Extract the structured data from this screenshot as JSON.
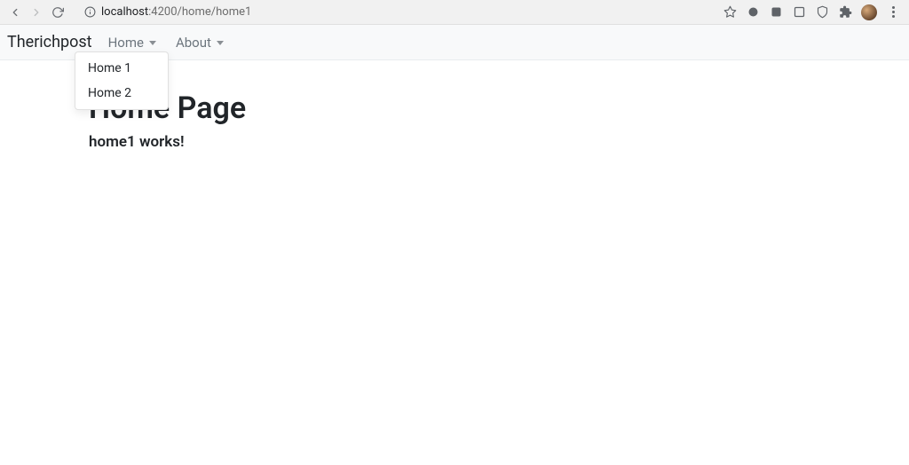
{
  "browser": {
    "url_host": "localhost",
    "url_port": ":4200",
    "url_path": "/home/home1"
  },
  "navbar": {
    "brand": "Therichpost",
    "items": [
      {
        "label": "Home"
      },
      {
        "label": "About"
      }
    ]
  },
  "dropdown": {
    "items": [
      {
        "label": "Home 1"
      },
      {
        "label": "Home 2"
      }
    ]
  },
  "page": {
    "heading": "Home Page",
    "text": "home1 works!"
  }
}
